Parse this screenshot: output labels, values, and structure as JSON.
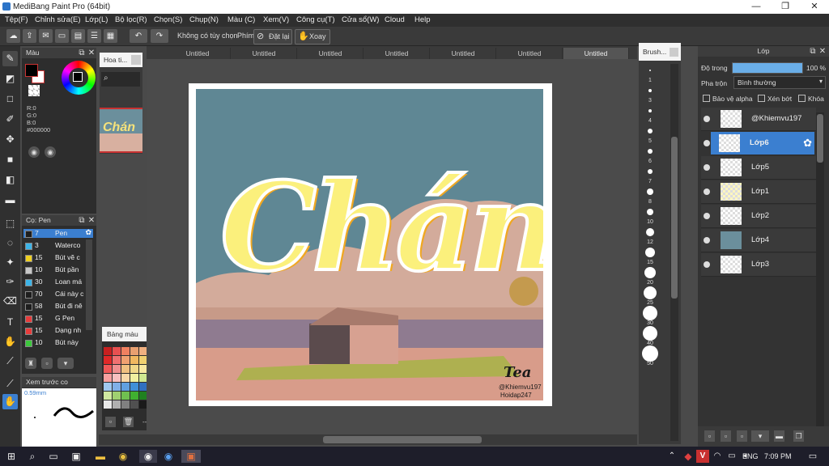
{
  "app": {
    "title": "MediBang Paint Pro (64bit)"
  },
  "menu": [
    "Tệp(F)",
    "Chỉnh sửa(E)",
    "Lớp(L)",
    "Bộ lọc(R)",
    "Chọn(S)",
    "Chụp(N)",
    "Màu (C)",
    "Xem(V)",
    "Công cụ(T)",
    "Cửa sổ(W)",
    "Cloud",
    "Help"
  ],
  "toolbar": {
    "no_option": "Không có tùy chọn",
    "keys": "Phím",
    "reset": "Đặt lại",
    "rotate": "Xoay"
  },
  "color_panel": {
    "title": "Màu",
    "r": "R:0",
    "g": "G:0",
    "b": "B:0",
    "hex": "#000000"
  },
  "navigator": {
    "title": "Hoa ti..."
  },
  "brush_panel": {
    "title": "Cọ: Pen",
    "items": [
      {
        "size": "7",
        "name": "Pen",
        "color": "#1e1e1e",
        "selected": true
      },
      {
        "size": "3",
        "name": "Waterco",
        "color": "#3db4e8"
      },
      {
        "size": "15",
        "name": "Bút vẽ c",
        "color": "#f0d020"
      },
      {
        "size": "10",
        "name": "Bút pần",
        "color": "#c8c8c8"
      },
      {
        "size": "30",
        "name": "Loan má",
        "color": "#3db4e8"
      },
      {
        "size": "70",
        "name": "Cái này c",
        "color": "#1e1e1e"
      },
      {
        "size": "58",
        "name": "Bút đi nê",
        "color": "#1e1e1e"
      },
      {
        "size": "15",
        "name": "G Pen",
        "color": "#e83c3c"
      },
      {
        "size": "15",
        "name": "Dạng nh",
        "color": "#e83c3c"
      },
      {
        "size": "10",
        "name": "Bút này",
        "color": "#3cc83c"
      }
    ]
  },
  "preview_panel": {
    "title": "Xem trước co",
    "size": "0.59mm"
  },
  "palette_panel": {
    "title": "Bảng màu",
    "colors": [
      "#c82020",
      "#e85050",
      "#f08060",
      "#e8a070",
      "#f0b080",
      "#f0c090",
      "#e02828",
      "#f07070",
      "#f0a070",
      "#f0b860",
      "#f0d070",
      "#f0e090",
      "#f05858",
      "#f09090",
      "#f0c080",
      "#f0d888",
      "#f8e8a0",
      "#f8f0c0",
      "#f8a0a0",
      "#f8c0c0",
      "#f8d8a8",
      "#f0f0a0",
      "#d0e890",
      "#b0d870",
      "#a0c8f0",
      "#80b0e8",
      "#60a0e0",
      "#4090d8",
      "#3070c0",
      "#2050a0",
      "#d0e8a0",
      "#a0d070",
      "#70c050",
      "#40b030",
      "#208020",
      "#106010",
      "#e8e8e8",
      "#b0b0b0",
      "#808080",
      "#505050",
      "#1a1a1a",
      "#ffffff"
    ],
    "footer": "---"
  },
  "tabs": [
    "Untitled",
    "Untitled",
    "Untitled",
    "Untitled",
    "Untitled",
    "Untitled",
    "Untitled"
  ],
  "artwork": {
    "title": "Chán",
    "signature": "Tea",
    "credit1": "@Khiemvu197",
    "credit2": "Hoidap247"
  },
  "brush_size_panel": {
    "title": "Brush...",
    "sizes": [
      "1",
      "3",
      "4",
      "5",
      "6",
      "7",
      "8",
      "10",
      "12",
      "15",
      "20",
      "25",
      "30",
      "40",
      "50"
    ]
  },
  "layer_panel": {
    "title": "Lớp",
    "opacity_label": "Độ trong",
    "opacity_value": "100 %",
    "blend_label": "Pha trộn",
    "blend_value": "Bình thường",
    "protect_alpha": "Bảo vệ alpha",
    "clipping": "Xén bớt",
    "lock": "Khóa",
    "layers": [
      {
        "name": "@Khiemvu197",
        "selected": false
      },
      {
        "name": "Lớp6",
        "selected": true
      },
      {
        "name": "Lớp5",
        "selected": false
      },
      {
        "name": "Lớp1",
        "selected": false
      },
      {
        "name": "Lớp2",
        "selected": false
      },
      {
        "name": "Lớp4",
        "selected": false
      },
      {
        "name": "Lớp3",
        "selected": false
      }
    ]
  },
  "taskbar": {
    "lang": "ENG",
    "time": "7:09 PM"
  }
}
